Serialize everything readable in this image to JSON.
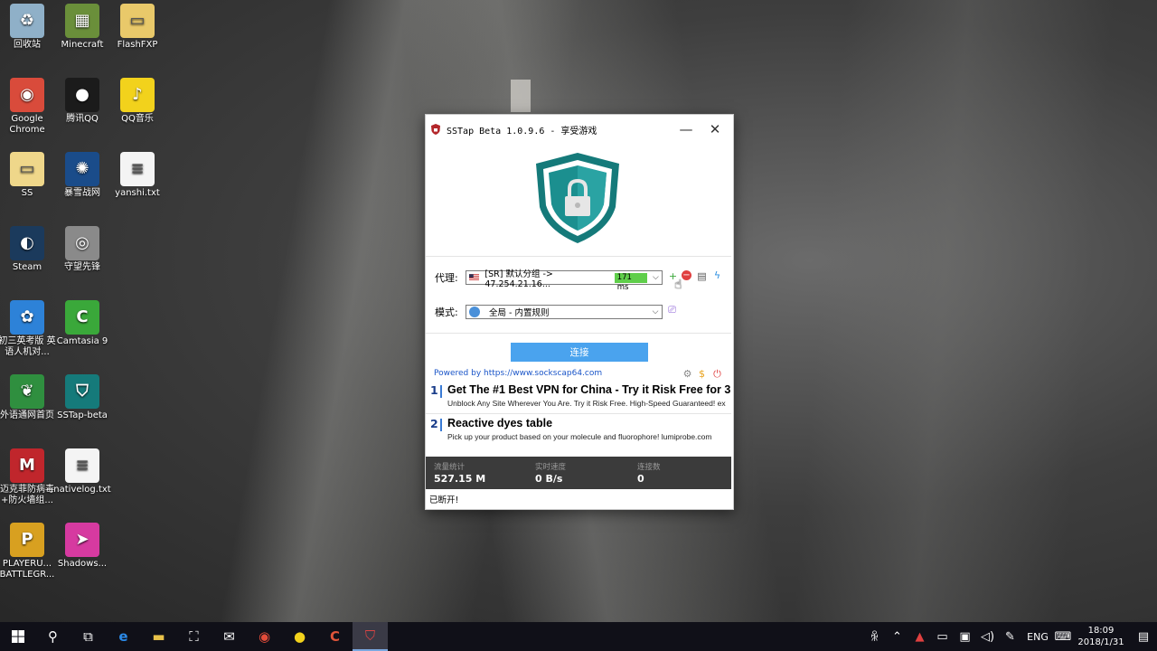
{
  "desktop": {
    "icons": [
      {
        "label": "回收站",
        "icon": "recycle-bin-icon",
        "color": "#8fb0c8",
        "glyph": "♻"
      },
      {
        "label": "Minecraft",
        "icon": "minecraft-icon",
        "color": "#6a8f3a",
        "glyph": "▦"
      },
      {
        "label": "FlashFXP",
        "icon": "folder-icon",
        "color": "#e9c96a",
        "glyph": "▭"
      },
      {
        "label": "Google Chrome",
        "icon": "chrome-icon",
        "color": "#d94b3b",
        "glyph": "◉"
      },
      {
        "label": "腾讯QQ",
        "icon": "qq-icon",
        "color": "#1b1b1b",
        "glyph": "●"
      },
      {
        "label": "QQ音乐",
        "icon": "qq-music-icon",
        "color": "#f2d21c",
        "glyph": "♪"
      },
      {
        "label": "SS",
        "icon": "folder-icon",
        "color": "#efd78a",
        "glyph": "▭"
      },
      {
        "label": "暴雪战网",
        "icon": "battlenet-icon",
        "color": "#1a4c8a",
        "glyph": "✺"
      },
      {
        "label": "yanshi.txt",
        "icon": "text-file-icon",
        "color": "#f4f4f4",
        "glyph": "≡"
      },
      {
        "label": "Steam",
        "icon": "steam-icon",
        "color": "#1b3a5c",
        "glyph": "◐"
      },
      {
        "label": "守望先锋",
        "icon": "overwatch-icon",
        "color": "#8a8a8a",
        "glyph": "◎"
      },
      {
        "label": "初三英考版 英语人机对...",
        "icon": "app-blue-icon",
        "color": "#2d82d8",
        "glyph": "✿"
      },
      {
        "label": "Camtasia 9",
        "icon": "camtasia-icon",
        "color": "#3aa83a",
        "glyph": "C"
      },
      {
        "label": "外语通网首页",
        "icon": "leaf-icon",
        "color": "#2f8f3f",
        "glyph": "❦"
      },
      {
        "label": "SSTap-beta",
        "icon": "shield-icon",
        "color": "#157a7a",
        "glyph": "⛉"
      },
      {
        "label": "迈克菲防病毒+防火墙组...",
        "icon": "mcafee-icon",
        "color": "#c0262c",
        "glyph": "M"
      },
      {
        "label": "nativelog.txt",
        "icon": "text-file-icon",
        "color": "#f4f4f4",
        "glyph": "≡"
      },
      {
        "label": "PLAYERU... BATTLEGR...",
        "icon": "pubg-icon",
        "color": "#d8a020",
        "glyph": "P"
      },
      {
        "label": "Shadows...",
        "icon": "shadowsocks-icon",
        "color": "#d63aa0",
        "glyph": "➤"
      }
    ]
  },
  "window": {
    "title": "SSTap Beta 1.0.9.6 - 享受游戏",
    "minimize": "—",
    "close": "✕",
    "proxy_label": "代理:",
    "proxy_value": "[SR] 默认分组 -> 47.254.21.16...",
    "latency": "171 ms",
    "mode_label": "模式:",
    "mode_value": "全局 - 内置规则",
    "connect": "连接",
    "powered": "Powered by https://www.sockscap64.com",
    "ads": [
      {
        "num": "1",
        "title": "Get The #1 Best VPN for China - Try it Risk Free for 3",
        "sub": "Unblock Any Site Wherever You Are. Try it Risk Free. High-Speed Guaranteed! ex"
      },
      {
        "num": "2",
        "title": "Reactive dyes table",
        "sub": "Pick up your product based on your molecule and fluorophore! lumiprobe.com"
      }
    ],
    "stats": {
      "traffic_label": "流量统计",
      "traffic_value": "527.15 M",
      "speed_label": "实时速度",
      "speed_value": "0 B/s",
      "conn_label": "连接数",
      "conn_value": "0"
    },
    "status": "已断开!"
  },
  "taskbar": {
    "time": "18:09",
    "date": "2018/1/31",
    "lang": "ENG"
  },
  "colors": {
    "accent": "#4aa3ee",
    "shield": "#157a7a",
    "latency_bg": "#5fce4a"
  }
}
